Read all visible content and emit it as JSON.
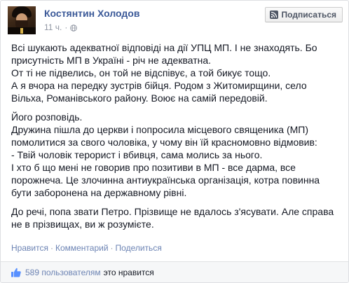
{
  "post": {
    "author": "Костянтин Холодов",
    "time": "11 ч.",
    "subscribe_label": "Подписаться",
    "paragraphs": [
      [
        "Всі шукають адекватної відповіді на дії УПЦ МП. І не знаходять. Бо",
        "присутність МП в Україні - річ не адекватна.",
        "От ті не підвелись, он той не відспівує, а той бикує тощо.",
        "А я вчора на передку зустрів бійця. Родом з Житомирщини, село",
        "Вільха, Романівського району. Воює на самій передовій."
      ],
      [
        "Його розповідь.",
        "Дружина пішла до церкви і попросила місцевого священика (МП)",
        "помолитися за свого чоловіка, у чому він їй красномовно відмовив:",
        "- Твій чоловік терорист і вбивця, сама молись за нього.",
        "І хто б що мені не говорив про позитиви в МП - все дарма, все",
        "порожнеча. Це злочинна антиукраїнська організація, котра повинна",
        "бути заборонена на державному рівні."
      ],
      [
        "До речі, попа звати Петро. Прізвище не вдалось з'ясувати. Але справа",
        "не в прізвищах, ви ж розумієте."
      ]
    ],
    "actions": {
      "like": "Нравится",
      "comment": "Комментарий",
      "share": "Поделиться"
    },
    "likes": {
      "count_text": "589 пользователям",
      "suffix": "это нравится"
    }
  },
  "colors": {
    "link": "#3b5998",
    "muted": "#9197a3",
    "action_link": "#6d84b4"
  },
  "icons": {
    "privacy": "globe-icon",
    "subscribe": "rss-icon",
    "like": "thumbs-up-icon"
  }
}
